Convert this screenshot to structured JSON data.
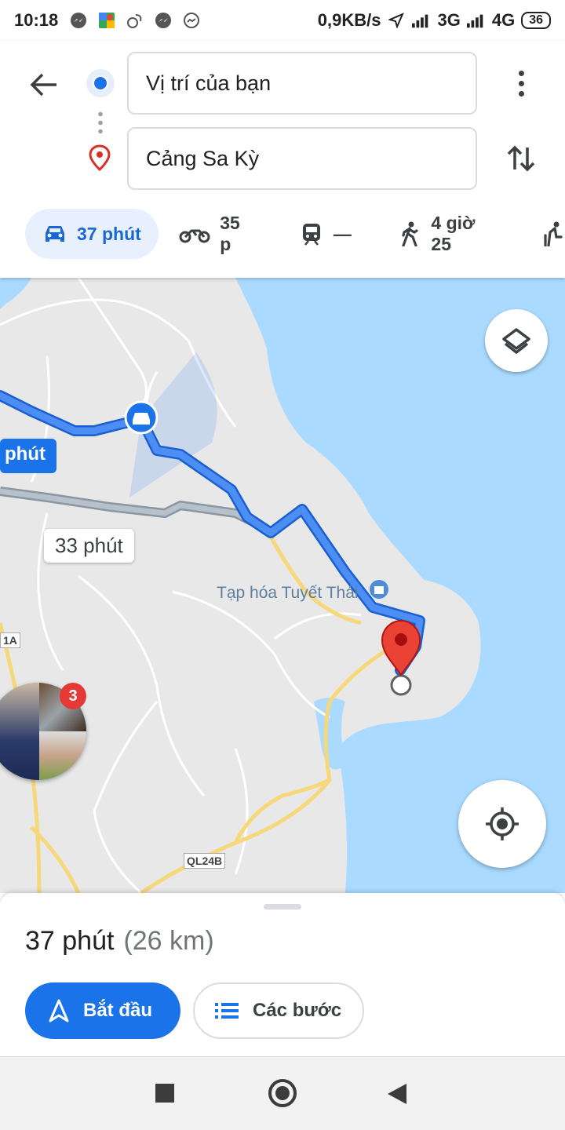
{
  "status_bar": {
    "time": "10:18",
    "network_speed": "0,9KB/s",
    "signal1": "3G",
    "signal2": "4G",
    "battery": "36"
  },
  "directions": {
    "origin": "Vị trí của bạn",
    "destination": "Cảng Sa Kỳ",
    "modes": [
      {
        "icon": "car-icon",
        "label": "37 phút",
        "active": true
      },
      {
        "icon": "motorbike-icon",
        "label": "35 p"
      },
      {
        "icon": "train-icon",
        "label": "—"
      },
      {
        "icon": "walk-icon",
        "label": "4 giờ 25"
      }
    ]
  },
  "map": {
    "route_chip_selected": "phút",
    "route_chip_alt": "33 phút",
    "poi": "Tạp hóa Tuyết Thái",
    "road_1a": "1A",
    "road_ql24b": "QL24B",
    "chat_badge": "3",
    "colors": {
      "water": "#aadaff",
      "land": "#e8e8e8",
      "route": "#4285f4",
      "alt_route": "#aab4be",
      "road": "#f6d77a"
    }
  },
  "sheet": {
    "duration": "37 phút",
    "distance": "(26 km)",
    "start_label": "Bắt đầu",
    "steps_label": "Các bước"
  }
}
